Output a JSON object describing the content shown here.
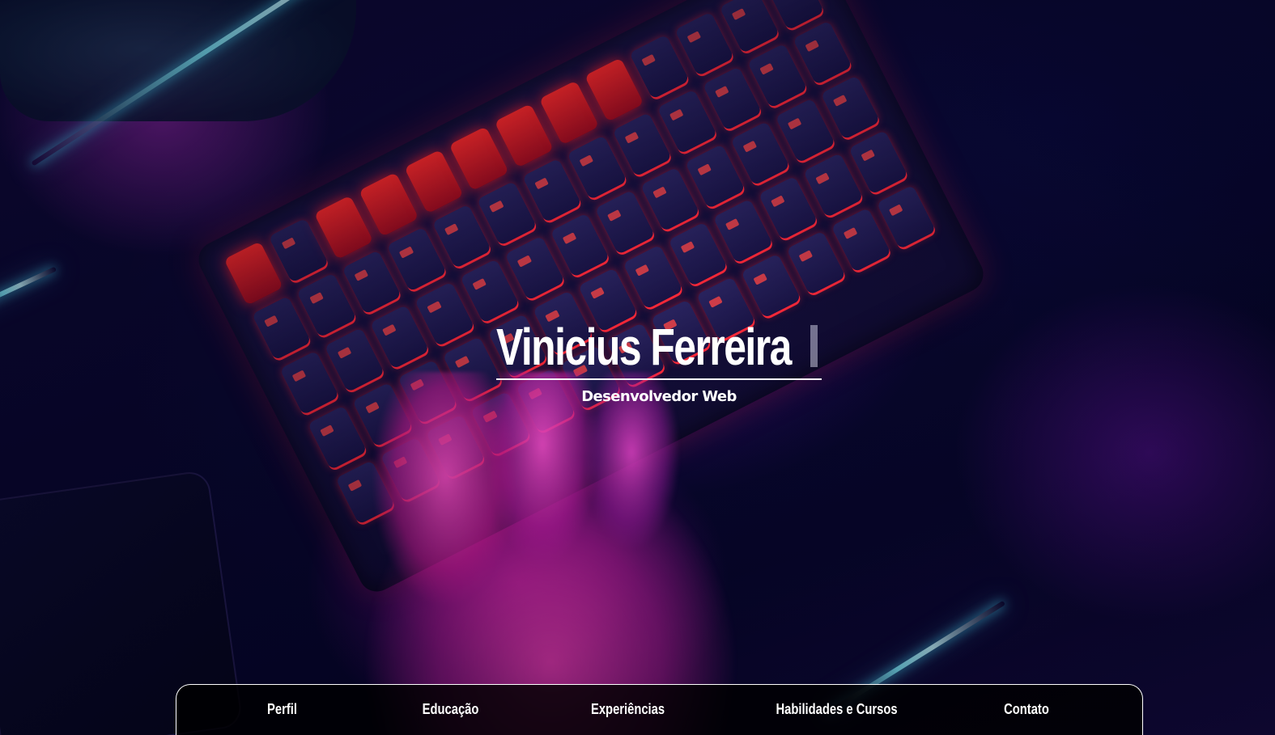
{
  "hero": {
    "title": "Vinicius Ferreira",
    "subtitle": "Desenvolvedor Web"
  },
  "nav": {
    "items": [
      {
        "label": "Perfil"
      },
      {
        "label": "Educação"
      },
      {
        "label": "Experiências"
      },
      {
        "label": "Habilidades e Cursos"
      },
      {
        "label": "Contato"
      }
    ]
  },
  "colors": {
    "text": "#ffffff",
    "nav_background": "#000000",
    "accent_red": "#ff2a3a",
    "accent_magenta": "#e23cb4",
    "accent_cyan": "#7ff0ff"
  }
}
